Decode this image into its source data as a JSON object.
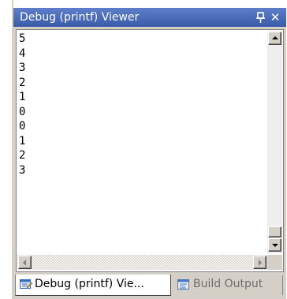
{
  "window": {
    "title": "Debug (printf) Viewer",
    "pin_glyph": "p",
    "close_glyph": "✕"
  },
  "output": {
    "lines": [
      "5",
      "4",
      "3",
      "2",
      "1",
      "0",
      "0",
      "1",
      "2",
      "3"
    ]
  },
  "tabs": [
    {
      "label": "Debug (printf) Vie...",
      "icon": "debug-viewer-icon",
      "active": true
    },
    {
      "label": "Build Output",
      "icon": "build-output-icon",
      "active": false
    }
  ],
  "colors": {
    "titlebar": "#3a5ba8",
    "panel": "#d4d0c8",
    "content_background": "#ffffff",
    "inactive_tab_text": "#6d6d6d"
  }
}
